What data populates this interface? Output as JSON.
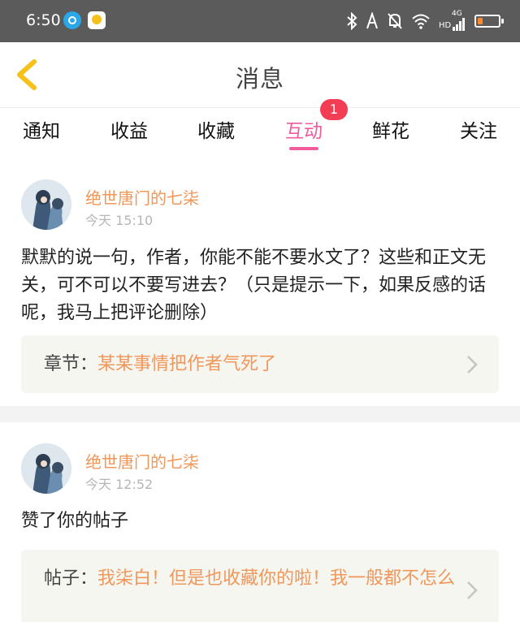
{
  "status_bar": {
    "time": "6:50",
    "network": "4G",
    "hd": "HD",
    "battery_level": 0.25,
    "battery_color": "#ff8a2a"
  },
  "header": {
    "title": "消息",
    "back_icon": "chevron-left-icon",
    "accent_color": "#f5c11b"
  },
  "tabs": {
    "items": [
      "通知",
      "收益",
      "收藏",
      "互动",
      "鲜花",
      "关注"
    ],
    "active_index": 3,
    "active_color": "#ef5b9c",
    "badge_count": "1"
  },
  "posts": [
    {
      "username": "绝世唐门的七柒",
      "time": "今天 15:10",
      "content": "默默的说一句，作者，你能不能不要水文了？这些和正文无关，可不可以不要写进去？（只是提示一下，如果反感的话呢，我马上把评论删除）",
      "ref_label": "章节：",
      "ref_value": "某某事情把作者气死了"
    },
    {
      "username": "绝世唐门的七柒",
      "time": "今天 12:52",
      "content": "赞了你的帖子",
      "ref_label": "帖子：",
      "ref_value": "我柒白！但是也收藏你的啦！我一般都不怎么"
    }
  ]
}
